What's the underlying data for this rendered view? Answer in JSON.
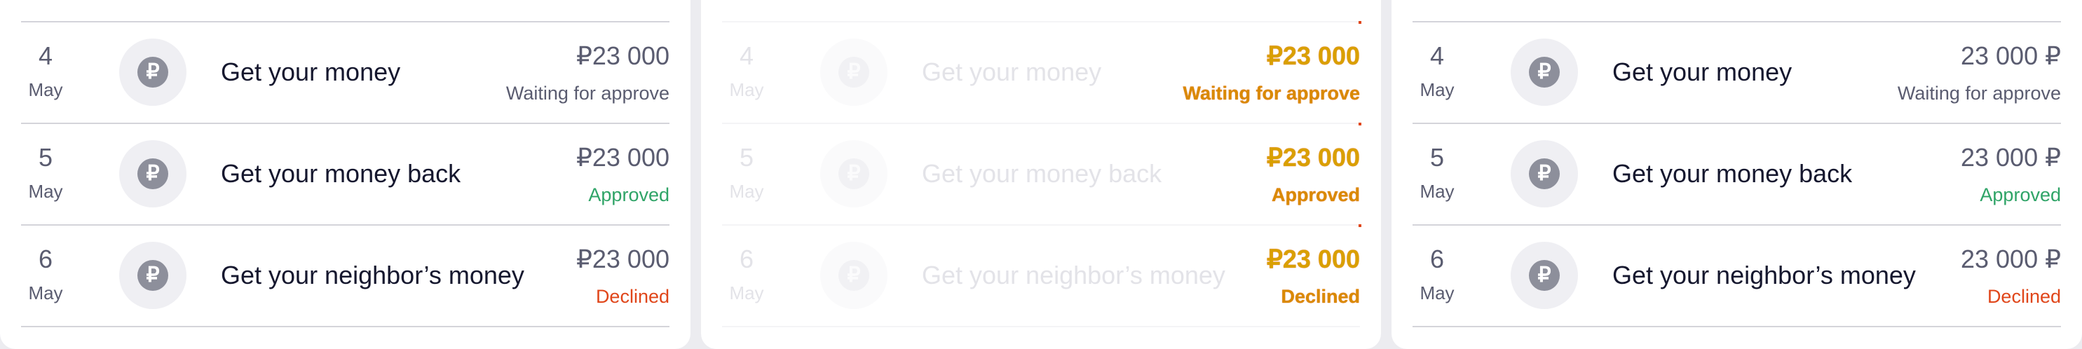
{
  "panels": [
    {
      "transactions": [
        {
          "day": "4",
          "month": "May",
          "title": "Get your money",
          "amount": "₽23 000",
          "status": "Waiting for approve",
          "status_type": "waiting",
          "icon": "ruble-icon"
        },
        {
          "day": "5",
          "month": "May",
          "title": "Get your money back",
          "amount": "₽23 000",
          "status": "Approved",
          "status_type": "approved",
          "icon": "ruble-icon"
        },
        {
          "day": "6",
          "month": "May",
          "title": "Get your neighbor’s money",
          "amount": "₽23 000",
          "status": "Declined",
          "status_type": "declined",
          "icon": "ruble-icon"
        }
      ]
    },
    {
      "transactions": [
        {
          "day": "4",
          "month": "May",
          "title": "Get your money",
          "amount": "₽23 000",
          "status": "Waiting for approve",
          "status_type": "waiting",
          "icon": "ruble-icon"
        },
        {
          "day": "5",
          "month": "May",
          "title": "Get your money back",
          "amount": "₽23 000",
          "status": "Approved",
          "status_type": "approved",
          "icon": "ruble-icon"
        },
        {
          "day": "6",
          "month": "May",
          "title": "Get your neighbor’s money",
          "amount": "₽23 000",
          "status": "Declined",
          "status_type": "declined",
          "icon": "ruble-icon"
        }
      ]
    },
    {
      "transactions": [
        {
          "day": "4",
          "month": "May",
          "title": "Get your money",
          "amount": "23 000 ₽",
          "status": "Waiting for approve",
          "status_type": "waiting",
          "icon": "ruble-icon"
        },
        {
          "day": "5",
          "month": "May",
          "title": "Get your money back",
          "amount": "23 000 ₽",
          "status": "Approved",
          "status_type": "approved",
          "icon": "ruble-icon"
        },
        {
          "day": "6",
          "month": "May",
          "title": "Get your neighbor’s money",
          "amount": "23 000 ₽",
          "status": "Declined",
          "status_type": "declined",
          "icon": "ruble-icon"
        }
      ]
    }
  ],
  "icon_glyph": "₽",
  "colors": {
    "approved": "#2fa467",
    "declined": "#e0461a",
    "waiting": "#5a5c70",
    "text": "#15172e"
  }
}
